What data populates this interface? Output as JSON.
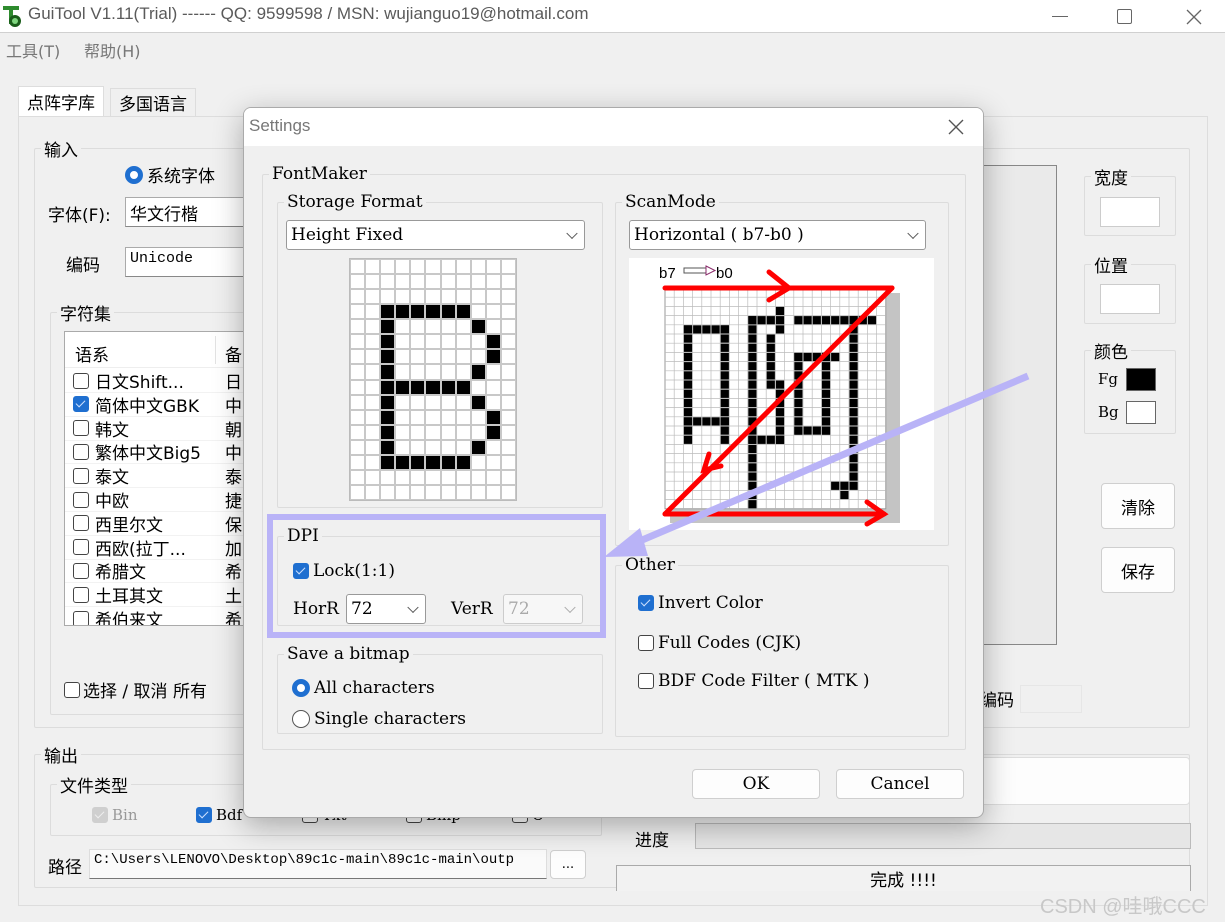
{
  "window": {
    "title": "GuiTool V1.11(Trial) ------ QQ: 9599598 / MSN: wujianguo19@hotmail.com",
    "minimize_icon": "minimize-icon",
    "maximize_icon": "maximize-icon",
    "close_icon": "close-icon"
  },
  "menu": {
    "items": [
      {
        "label": "工具(T)"
      },
      {
        "label": "帮助(H)"
      }
    ]
  },
  "tabs": [
    {
      "label": "点阵字库",
      "active": true
    },
    {
      "label": "多国语言",
      "active": false
    }
  ],
  "input_group": {
    "legend": "输入",
    "system_font_label": "系统字体",
    "system_font_selected": true,
    "font_label": "字体(F):",
    "font_value": "华文行楷",
    "encoding_label": "编码",
    "encoding_value": "Unicode",
    "charset_legend": "字符集",
    "charset_headers": [
      "语系",
      "备"
    ],
    "charset_rows": [
      {
        "name": "日文Shift...",
        "note": "日",
        "checked": false
      },
      {
        "name": "简体中文GBK",
        "note": "中",
        "checked": true
      },
      {
        "name": "韩文",
        "note": "朝",
        "checked": false
      },
      {
        "name": "繁体中文Big5",
        "note": "中",
        "checked": false
      },
      {
        "name": "泰文",
        "note": "泰",
        "checked": false
      },
      {
        "name": "中欧",
        "note": "捷",
        "checked": false
      },
      {
        "name": "西里尔文",
        "note": "保",
        "checked": false
      },
      {
        "name": "西欧(拉丁...",
        "note": "加",
        "checked": false
      },
      {
        "name": "希腊文",
        "note": "希",
        "checked": false
      },
      {
        "name": "土耳其文",
        "note": "土",
        "checked": false
      },
      {
        "name": "希伯来文",
        "note": "希",
        "checked": false
      }
    ],
    "select_all_label": "选择 / 取消 所有",
    "select_all_checked": false
  },
  "output_group": {
    "legend": "输出",
    "filetype_legend": "文件类型",
    "filetypes": [
      {
        "label": "Bin",
        "checked": true,
        "disabled": true
      },
      {
        "label": "Bdf",
        "checked": true,
        "disabled": false
      },
      {
        "label": "Txt",
        "checked": false,
        "disabled": false
      },
      {
        "label": "Bmp",
        "checked": false,
        "disabled": false
      },
      {
        "label": "C",
        "checked": false,
        "disabled": false
      }
    ],
    "path_label": "路径",
    "path_value": "C:\\Users\\LENOVO\\Desktop\\89c1c-main\\89c1c-main\\outp",
    "browse_label": "..."
  },
  "right_panel": {
    "width_legend": "宽度",
    "width_value": "",
    "position_legend": "位置",
    "position_value": "",
    "color_legend": "颜色",
    "fg_label": "Fg",
    "fg_color": "#000000",
    "bg_label": "Bg",
    "bg_color": "#ffffff",
    "clear_label": "清除",
    "save_label": "保存",
    "code_label": "编码",
    "code_value": ""
  },
  "status": {
    "progress_label": "进度",
    "progress_value": 0,
    "done_text": "完成 !!!!"
  },
  "dialog": {
    "title": "Settings",
    "fontmaker_legend": "FontMaker",
    "storage_format": {
      "legend": "Storage Format",
      "value": "Height Fixed"
    },
    "scanmode": {
      "legend": "ScanMode",
      "value": "Horizontal ( b7-b0 )",
      "diagram_label_left": "b7",
      "diagram_label_right": "b0"
    },
    "preview_glyph": {
      "char": "B",
      "cols": 11,
      "rows": 16,
      "pixels": [
        "...........",
        "...........",
        "...........",
        "..XXXXXX...",
        "..X.....X..",
        "..X......X.",
        "..X......X.",
        "..X.....X..",
        "..XXXXXX...",
        "..X.....X..",
        "..X......X.",
        "..X......X.",
        "..X.....X..",
        "..XXXXXX...",
        "...........",
        "..........."
      ]
    },
    "dpi": {
      "legend": "DPI",
      "lock_label": "Lock(1:1)",
      "lock_checked": true,
      "horr_label": "HorR",
      "horr_value": "72",
      "verr_label": "VerR",
      "verr_value": "72",
      "verr_disabled": true
    },
    "save_bitmap": {
      "legend": "Save a bitmap",
      "options": [
        {
          "label": "All characters",
          "selected": true
        },
        {
          "label": "Single characters",
          "selected": false
        }
      ]
    },
    "other": {
      "legend": "Other",
      "options": [
        {
          "label": "Invert Color",
          "checked": true
        },
        {
          "label": "Full Codes (CJK)",
          "checked": false
        },
        {
          "label": "BDF Code Filter ( MTK )",
          "checked": false
        }
      ]
    },
    "ok_label": "OK",
    "cancel_label": "Cancel"
  },
  "annotation": {
    "highlight_color": "#b9b3f7",
    "arrow_color": "#b9b3f7"
  },
  "watermark": "CSDN @哇哦CCC"
}
